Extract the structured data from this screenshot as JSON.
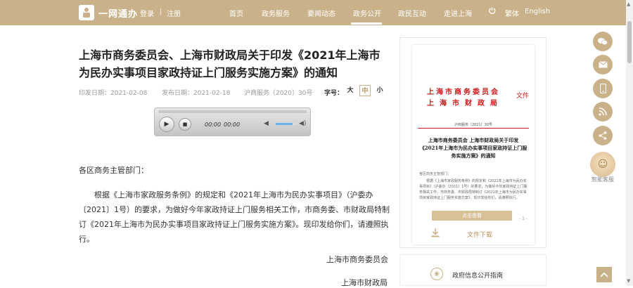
{
  "header": {
    "logo_text": "一网通办",
    "login": "登录",
    "separator": "|",
    "register": "注册",
    "nav": [
      "首页",
      "政务服务",
      "要闻动态",
      "政务公开",
      "政民互动",
      "走进上海"
    ],
    "active_nav": "政务公开",
    "traditional": "繁体",
    "english": "English"
  },
  "article": {
    "title": "上海市商务委员会、上海市财政局关于印发《2021年上海市为民办实事项目家政持证上门服务实施方案》的通知",
    "print_date": "印发日期：2021-02-08",
    "publish_date": "发布日期：2021-02-18",
    "doc_number": "沪商服务〔2020〕30号",
    "font_label": "字号：",
    "font_sizes": [
      "大",
      "中",
      "小"
    ],
    "active_font": "中",
    "greeting": "各区商务主管部门：",
    "paragraph": "根据《上海市家政服务条例》的规定和《2021年上海市为民办实事项目》（沪委办〔2021〕1号）的要求，为做好今年家政持证上门服务相关工作，市商务委、市财政局特制订《2021年上海市为民办实事项目家政持证上门服务实施方案》。现印发给你们，请遵照执行。",
    "sign1": "上海市商务委员会",
    "sign2": "上海市财政局"
  },
  "player": {
    "current_time": "00:00",
    "duration": "00:00",
    "volume": 0.8
  },
  "doc_preview": {
    "org1": "上海市商务委员会",
    "org2": "上海市财政局",
    "wenjian": "文件",
    "number": "沪商服务〔2021〕30号",
    "title": "上海市商务委员会 上海市财政局关于印发《2021年上海市为民办实事项目家政持证上门服务实施方案》的通知",
    "greeting": "各区商务主管部门：",
    "body": "根据《上海市家政服务条例》的规定和《2021年上海市为民办实事项目》（沪委办〔2021〕1号）的要求，为做好今年家政持证上门服务相关工作，市商务委、市财政局特制订《2021年上海市为民办实事项目家政持证上门服务实施方案》。现印发给你们，请遵照执行。",
    "page": "- 1 -",
    "view_btn": "点击查看",
    "download": "文件下载"
  },
  "sidebar": {
    "guide": "政府信息公开指南",
    "robot_label": "智能客服"
  }
}
